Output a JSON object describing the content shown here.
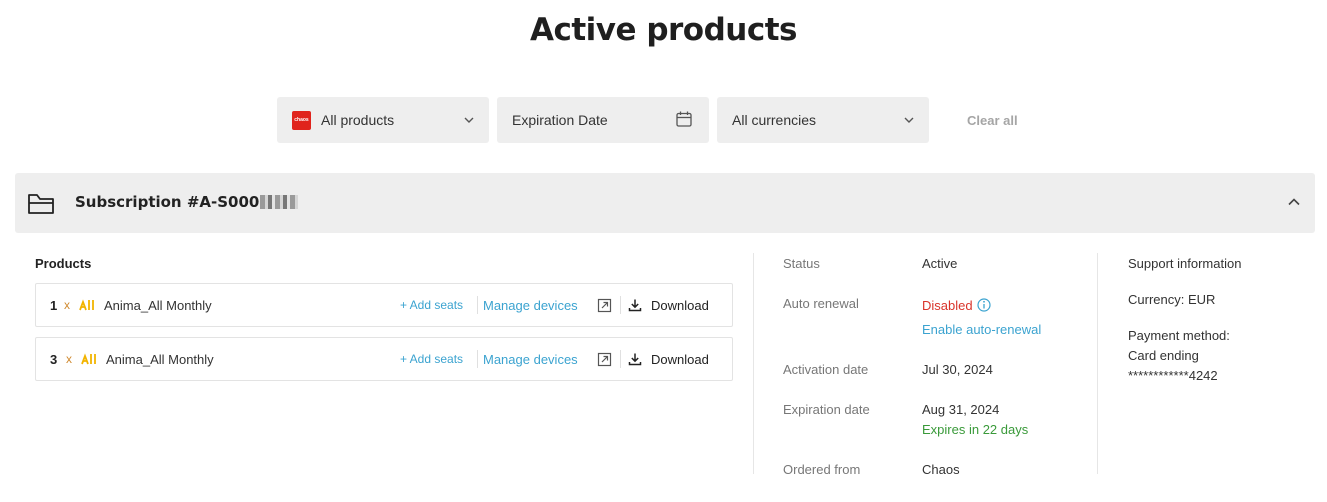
{
  "page": {
    "title": "Active products"
  },
  "filters": {
    "products": "All products",
    "products_logo_text": "chaos",
    "date": "Expiration Date",
    "currency": "All currencies",
    "clear_all": "Clear all"
  },
  "subscription": {
    "title": "Subscription #A-S000"
  },
  "products_section": {
    "label": "Products",
    "rows": [
      {
        "qty": "1",
        "times": "x",
        "name": "Anima_All Monthly",
        "add_seats": "+ Add seats",
        "manage": "Manage devices",
        "download": "Download"
      },
      {
        "qty": "3",
        "times": "x",
        "name": "Anima_All Monthly",
        "add_seats": "+ Add seats",
        "manage": "Manage devices",
        "download": "Download"
      }
    ]
  },
  "details": {
    "status_label": "Status",
    "status_value": "Active",
    "renewal_label": "Auto renewal",
    "renewal_value": "Disabled",
    "renewal_link": "Enable auto-renewal",
    "activation_label": "Activation date",
    "activation_value": "Jul 30, 2024",
    "expiration_label": "Expiration date",
    "expiration_value": "Aug 31, 2024",
    "expiration_note": "Expires in 22 days",
    "ordered_label": "Ordered from",
    "ordered_value": "Chaos"
  },
  "side": {
    "support": "Support information",
    "currency": "Currency: EUR",
    "payment_label": "Payment method:",
    "payment_card": "Card ending",
    "payment_number": "************4242"
  },
  "colors": {
    "accent": "#3ba3d0",
    "disabled": "#d9342b",
    "expires": "#3a9a3a",
    "brand": "#e0231c",
    "anima": "#f2b400"
  }
}
